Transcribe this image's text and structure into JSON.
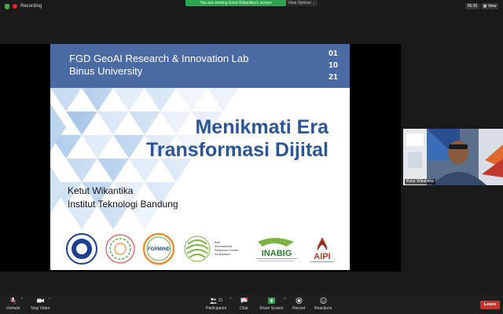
{
  "topbar": {
    "recording_label": "Recording",
    "share_banner": "You are viewing Ketut Wikantika's screen",
    "view_options_label": "View Options ⌄",
    "clock": "55:35",
    "view_label": "View"
  },
  "slide": {
    "lab_name": "FGD GeoAI Research & Innovation Lab",
    "university": "Binus University",
    "date_day": "01",
    "date_month": "10",
    "date_year": "21",
    "title_line1": "Menikmati Era",
    "title_line2": "Transformasi Dijital",
    "author": "Ketut Wikantika",
    "institution": "Institut Teknologi Bandung",
    "logos": {
      "itb": "itb-logo",
      "circle": "circle-logo",
      "formind": "FORMIND",
      "bali_text": "Bali International Research Center for Banana",
      "inabig": "INABIG",
      "aipi": "AIPI"
    }
  },
  "participant": {
    "name": "Ketut Wikantika"
  },
  "toolbar": {
    "unmute": "Unmute",
    "stop_video": "Stop Video",
    "participants": "Participants",
    "participants_count": "21",
    "chat": "Chat",
    "share_screen": "Share Screen",
    "record": "Record",
    "reactions": "Reactions",
    "leave": "Leave"
  },
  "colors": {
    "accent_green": "#2da44e",
    "slide_header": "#4a6aa3",
    "title_blue": "#2c5596",
    "leave_red": "#d32f2f"
  }
}
